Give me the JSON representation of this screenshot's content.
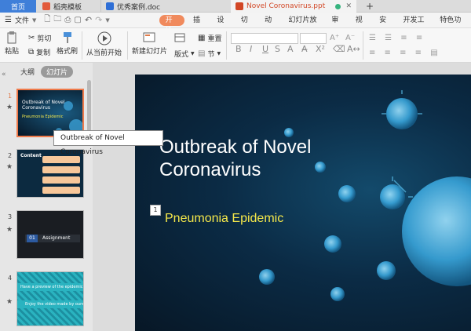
{
  "tabs": {
    "home": "首页",
    "template": "稻壳模板",
    "doc": "优秀案例.doc",
    "ppt": "Novel Coronavirus.ppt",
    "add": "+"
  },
  "menubar": {
    "file": "文件",
    "items": [
      "开始",
      "插入",
      "设计",
      "切换",
      "动画",
      "幻灯片放映",
      "审阅",
      "视图",
      "安全",
      "开发工具",
      "特色功能"
    ]
  },
  "ribbon": {
    "paste": "粘贴",
    "cut": "剪切",
    "copy": "复制",
    "format_painter": "格式刷",
    "play_from_current": "从当前开始",
    "new_slide": "新建幻灯片",
    "layout": "版式",
    "section": "节",
    "reset": "重置"
  },
  "leftpanel": {
    "outline_tab": "大纲",
    "slides_tab": "幻灯片",
    "tooltip": "Outbreak of Novel Coronavirus",
    "thumbs": [
      {
        "num": "1",
        "title": "Outbreak of Novel Coronavirus",
        "sub": "Pneumonia Epidemic"
      },
      {
        "num": "2",
        "title": "Content"
      },
      {
        "num": "3",
        "badge": "01",
        "label": "Assignment"
      },
      {
        "num": "4",
        "line1": "Have a preview of the epidemic words",
        "line2": "Enjoy the video made by ourselves"
      }
    ]
  },
  "slide": {
    "title": "Outbreak of Novel Coronavirus",
    "subtitle": "Pneumonia Epidemic",
    "marker": "1"
  },
  "colors": {
    "accent_orange": "#f08a5d",
    "home_tab": "#3f7fd9",
    "title_yellow": "#f5e84a",
    "slide_bg": "#0b2b45",
    "virus_blue": "#4fb6e8"
  }
}
